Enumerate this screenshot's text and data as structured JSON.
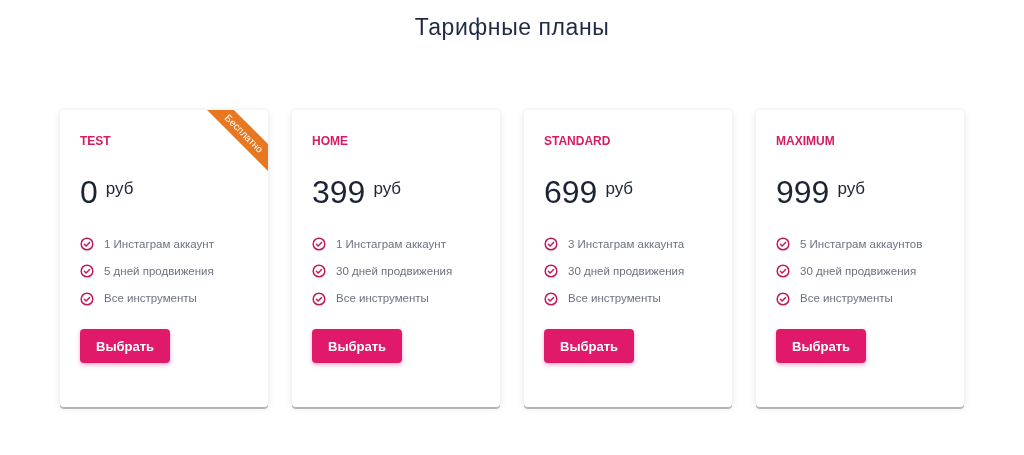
{
  "title": "Тарифные планы",
  "plans": [
    {
      "name": "TEST",
      "price": "0",
      "currency": "руб",
      "ribbon": "Бесплатно",
      "features": [
        "1 Инстаграм аккаунт",
        "5 дней продвижения",
        "Все инструменты"
      ],
      "button": "Выбрать"
    },
    {
      "name": "HOME",
      "price": "399",
      "currency": "руб",
      "features": [
        "1 Инстаграм аккаунт",
        "30 дней продвижения",
        "Все инструменты"
      ],
      "button": "Выбрать"
    },
    {
      "name": "STANDARD",
      "price": "699",
      "currency": "руб",
      "features": [
        "3 Инстаграм аккаунта",
        "30 дней продвижения",
        "Все инструменты"
      ],
      "button": "Выбрать"
    },
    {
      "name": "MAXIMUM",
      "price": "999",
      "currency": "руб",
      "features": [
        "5 Инстаграм аккаунтов",
        "30 дней продвижения",
        "Все инструменты"
      ],
      "button": "Выбрать"
    }
  ]
}
